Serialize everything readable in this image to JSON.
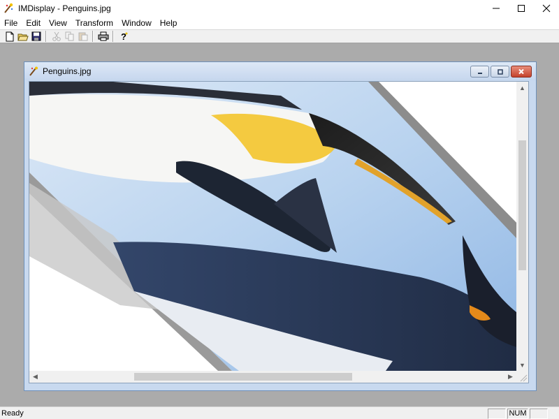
{
  "app": {
    "title": "IMDisplay - Penguins.jpg"
  },
  "window_controls": {
    "minimize": "—",
    "maximize": "☐",
    "close": "✕"
  },
  "menu": [
    "File",
    "Edit",
    "View",
    "Transform",
    "Window",
    "Help"
  ],
  "toolbar": {
    "buttons": [
      {
        "icon": "new-file-icon",
        "enabled": true
      },
      {
        "icon": "open-folder-icon",
        "enabled": true
      },
      {
        "icon": "save-icon",
        "enabled": true
      },
      {
        "icon": "cut-icon",
        "enabled": false
      },
      {
        "icon": "copy-icon",
        "enabled": false
      },
      {
        "icon": "paste-icon",
        "enabled": false
      },
      {
        "icon": "print-icon",
        "enabled": true
      },
      {
        "icon": "help-icon",
        "enabled": true
      }
    ]
  },
  "child_window": {
    "title": "Penguins.jpg",
    "image_name": "rotated-penguins-image"
  },
  "status": {
    "text": "Ready",
    "panes": [
      "",
      "NUM",
      ""
    ]
  },
  "colors": {
    "mdi_background": "#ababab",
    "child_title": "#c6d7ee",
    "close_button": "#c4422c"
  }
}
